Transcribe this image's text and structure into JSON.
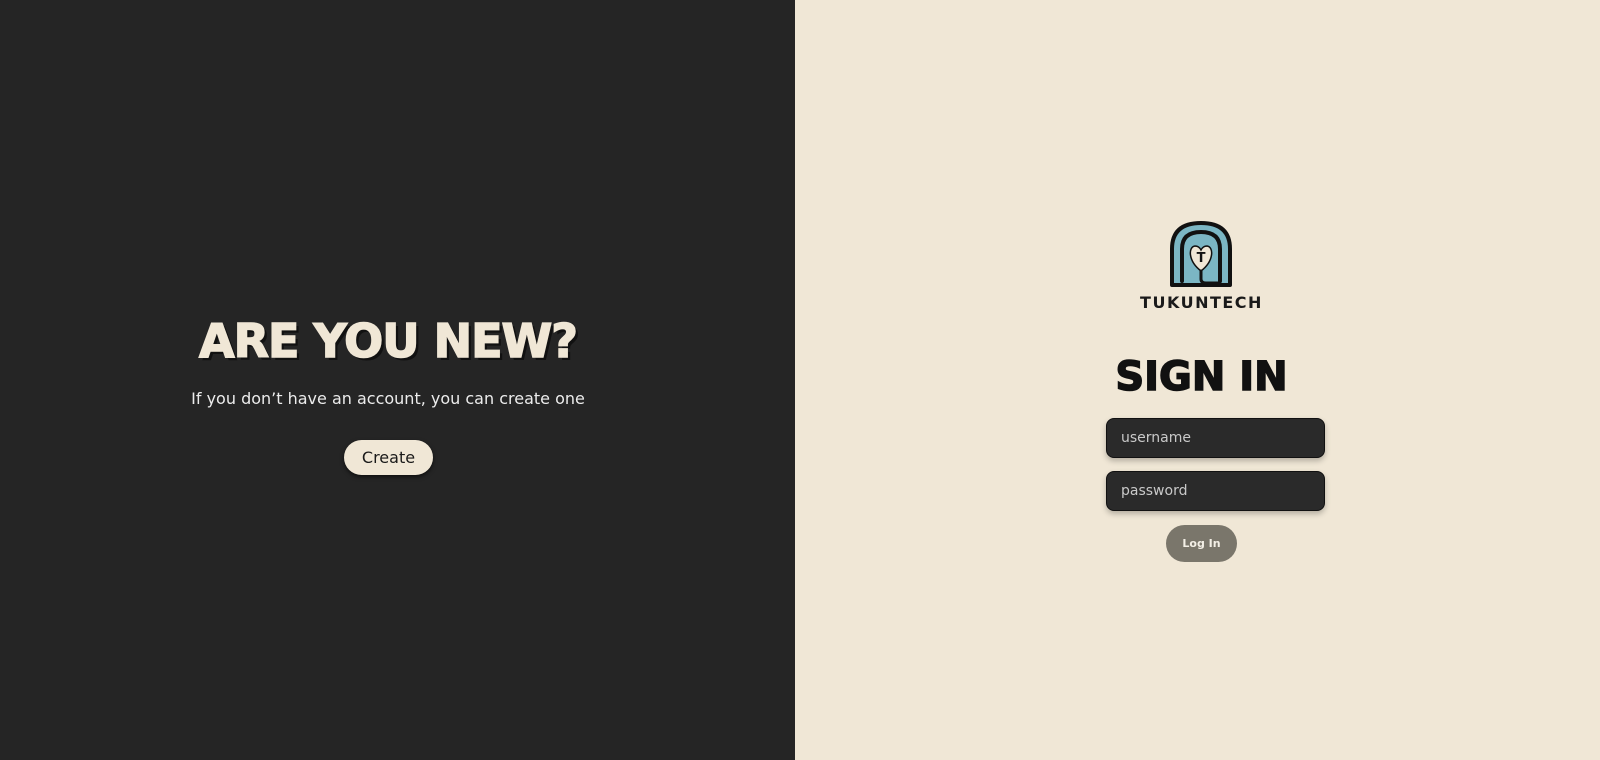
{
  "new_account": {
    "title": "ARE YOU NEW?",
    "subtitle": "If you don’t have an account, you can create one",
    "create_label": "Create"
  },
  "brand": {
    "name": "TUKUNTECH",
    "logo_letter": "T"
  },
  "signin": {
    "title": "SIGN IN",
    "username_placeholder": "username",
    "password_placeholder": "password",
    "login_label": "Log In"
  },
  "colors": {
    "dark_panel": "#252525",
    "light_panel": "#f0e7d6",
    "logo_blue": "#7bb6c4",
    "login_button": "#7a766b",
    "input_bg": "#2a2a2a"
  }
}
